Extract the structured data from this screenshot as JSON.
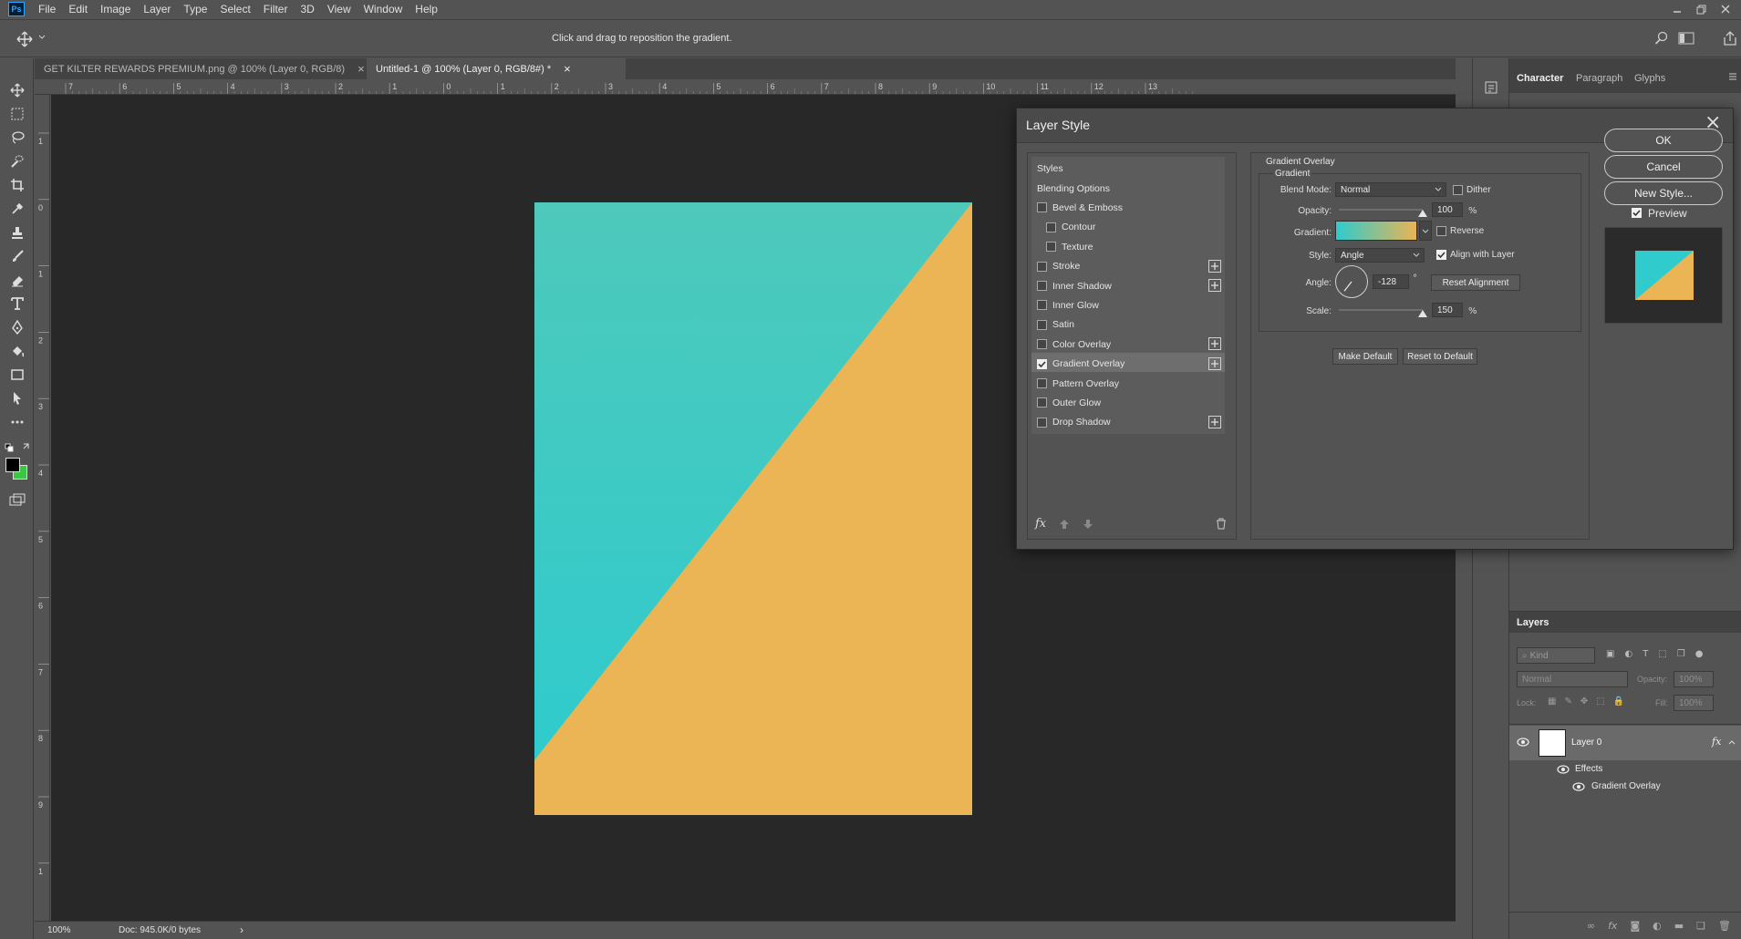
{
  "app": {
    "logo": "Ps"
  },
  "menu": {
    "items": [
      "File",
      "Edit",
      "Image",
      "Layer",
      "Type",
      "Select",
      "Filter",
      "3D",
      "View",
      "Window",
      "Help"
    ]
  },
  "options_bar": {
    "hint": "Click and drag to reposition the gradient."
  },
  "tabs": [
    {
      "label": "GET KILTER REWARDS PREMIUM.png @ 100% (Layer 0, RGB/8)",
      "close": "×"
    },
    {
      "label": "Untitled-1 @ 100% (Layer 0, RGB/8#) *",
      "close": "×"
    }
  ],
  "rulers": {
    "top": [
      "7",
      "6",
      "5",
      "4",
      "3",
      "2",
      "1",
      "0",
      "1",
      "2",
      "3",
      "4",
      "5",
      "6",
      "7",
      "8",
      "9",
      "10",
      "11",
      "12",
      "13"
    ],
    "left": [
      "1",
      "0",
      "1",
      "2",
      "3",
      "4",
      "5",
      "6",
      "7",
      "8",
      "9",
      "1"
    ]
  },
  "status": {
    "zoom": "100%",
    "doc": "Doc: 945.0K/0 bytes",
    "arrow": "›"
  },
  "artwork": {
    "color_a": "#2fcbcd",
    "color_b": "#ebb454",
    "color_a_light": "#4ec9bb"
  },
  "toolbar": {
    "fg_color": "#000000",
    "bg_color": "#3cc646"
  },
  "right_panel": {
    "character_tabs": [
      "Character",
      "Paragraph",
      "Glyphs"
    ],
    "layers_title": "Layers",
    "filter_placeholder": "Kind",
    "blend": "Normal",
    "opacity_label": "Opacity:",
    "opacity_value": "100%",
    "lock_label": "Lock:",
    "fill_label": "Fill:",
    "fill_value": "100%",
    "layer_name": "Layer 0",
    "fx": "fx",
    "effects_label": "Effects",
    "effect_item": "Gradient Overlay"
  },
  "dialog": {
    "title": "Layer Style",
    "close": "×",
    "styles": [
      {
        "label": "Styles",
        "type": "header"
      },
      {
        "label": "Blending Options",
        "type": "header"
      },
      {
        "label": "Bevel & Emboss",
        "checked": false,
        "plus": false
      },
      {
        "label": "Contour",
        "checked": false,
        "plus": false,
        "indent": true
      },
      {
        "label": "Texture",
        "checked": false,
        "plus": false,
        "indent": true
      },
      {
        "label": "Stroke",
        "checked": false,
        "plus": true
      },
      {
        "label": "Inner Shadow",
        "checked": false,
        "plus": true
      },
      {
        "label": "Inner Glow",
        "checked": false,
        "plus": false
      },
      {
        "label": "Satin",
        "checked": false,
        "plus": false
      },
      {
        "label": "Color Overlay",
        "checked": false,
        "plus": true
      },
      {
        "label": "Gradient Overlay",
        "checked": true,
        "plus": true,
        "selected": true
      },
      {
        "label": "Pattern Overlay",
        "checked": false,
        "plus": false
      },
      {
        "label": "Outer Glow",
        "checked": false,
        "plus": false
      },
      {
        "label": "Drop Shadow",
        "checked": false,
        "plus": true
      }
    ],
    "footer_fx": "fx",
    "section_title": "Gradient Overlay",
    "group_title": "Gradient",
    "blend_mode_label": "Blend Mode:",
    "blend_mode_value": "Normal",
    "dither_label": "Dither",
    "dither_checked": false,
    "opacity_label": "Opacity:",
    "opacity_value": "100",
    "opacity_fraction": 1.0,
    "percent": "%",
    "gradient_label": "Gradient:",
    "gradient_colors": [
      "#2fcbcd",
      "#ebb454"
    ],
    "reverse_label": "Reverse",
    "reverse_checked": false,
    "style_label": "Style:",
    "style_value": "Angle",
    "align_label": "Align with Layer",
    "align_checked": true,
    "angle_label": "Angle:",
    "angle_value": "-128",
    "degree": "°",
    "reset_alignment": "Reset Alignment",
    "scale_label": "Scale:",
    "scale_value": "150",
    "scale_fraction": 1.0,
    "make_default": "Make Default",
    "reset_default": "Reset to Default",
    "ok": "OK",
    "cancel": "Cancel",
    "new_style": "New Style...",
    "preview_label": "Preview",
    "preview_checked": true
  }
}
